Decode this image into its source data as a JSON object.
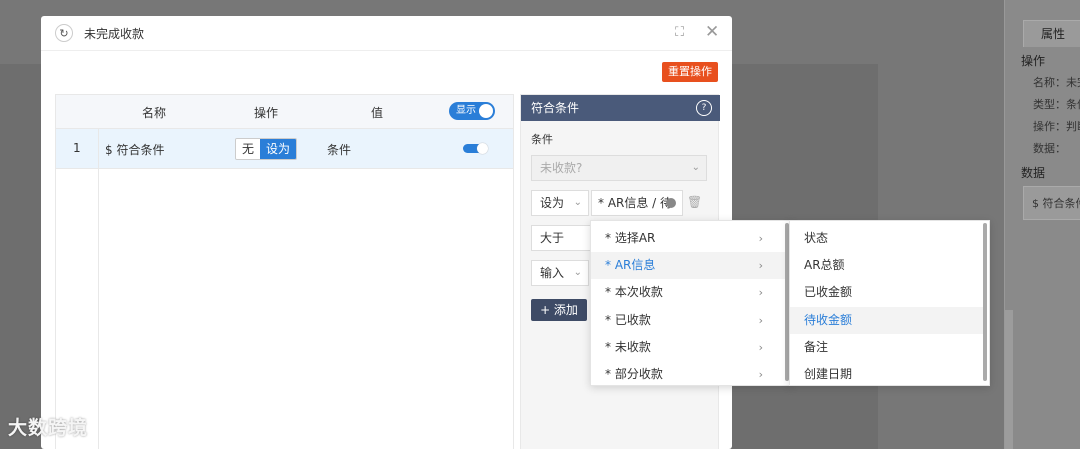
{
  "modal": {
    "title": "未完成收款",
    "refresh_icon": "↻",
    "expand_icon": "⛶",
    "close_icon": "✕",
    "reset_label": "重置操作"
  },
  "table": {
    "headers": {
      "name": "名称",
      "op": "操作",
      "value": "值"
    },
    "show_toggle_label": "显示",
    "rows": [
      {
        "index": "1",
        "name": "$ 符合条件",
        "op_off": "无",
        "op_on": "设为",
        "value": "条件"
      }
    ]
  },
  "condition_panel": {
    "title": "符合条件",
    "section_label": "条件",
    "placeholder_select": "未收款?",
    "row1": {
      "op": "设为",
      "value": "* AR信息 / 待"
    },
    "row2": {
      "op": "大于"
    },
    "row3": {
      "op": "输入"
    },
    "add_label": "+ 添加"
  },
  "menu_level1": [
    {
      "label": "* 选择AR"
    },
    {
      "label": "* AR信息"
    },
    {
      "label": "* 本次收款"
    },
    {
      "label": "* 已收款"
    },
    {
      "label": "* 未收款"
    },
    {
      "label": "* 部分收款"
    }
  ],
  "menu_level2": [
    {
      "label": "状态"
    },
    {
      "label": "AR总额"
    },
    {
      "label": "已收金额"
    },
    {
      "label": "待收金额"
    },
    {
      "label": "备注"
    },
    {
      "label": "创建日期"
    }
  ],
  "right_panel": {
    "tab": "属性",
    "section_ops": "操作",
    "name_row": "名称：未完成",
    "type_row": "类型：条件",
    "op_row": "操作：判断",
    "data_row": "数据：",
    "section_data": "数据",
    "data_box": "$ 符合条件"
  },
  "watermark": "大数跨境",
  "colors": {
    "primary": "#2a7ed8",
    "danger": "#e8501e",
    "panel_header": "#4a5a7a"
  }
}
